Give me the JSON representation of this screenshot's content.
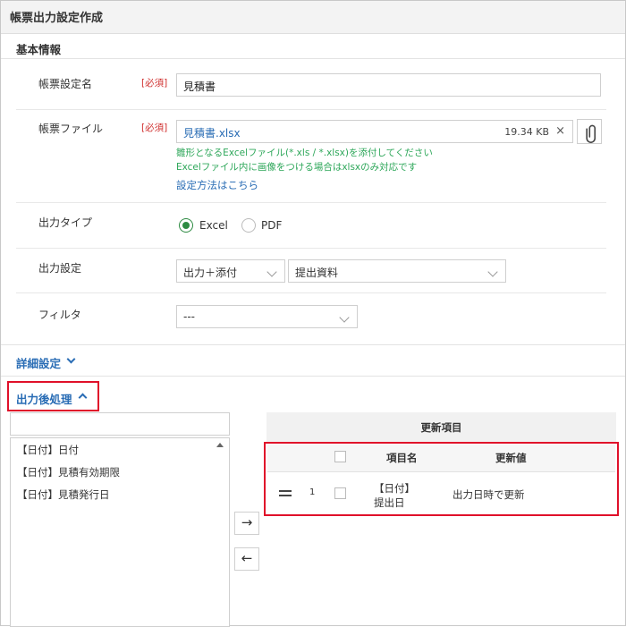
{
  "window": {
    "title": "帳票出力設定作成"
  },
  "basic": {
    "title": "基本情報",
    "report_name": {
      "label": "帳票設定名",
      "required": "[必須]",
      "value": "見積書"
    },
    "report_file": {
      "label": "帳票ファイル",
      "required": "[必須]",
      "file_name": "見積書.xlsx",
      "file_size": "19.34 KB",
      "clear_icon": "×",
      "attach_icon": "paperclip-icon",
      "note1": "雛形となるExcelファイル(*.xls / *.xlsx)を添付してください",
      "note2": "Excelファイル内に画像をつける場合はxlsxのみ対応です",
      "help_link": "設定方法はこちら"
    },
    "output_type": {
      "label": "出力タイプ",
      "options": [
        "Excel",
        "PDF"
      ],
      "selected": "Excel"
    },
    "output_setting": {
      "label": "出力設定",
      "select1": "出力＋添付",
      "select2": "提出資料"
    },
    "filter": {
      "label": "フィルタ",
      "value": "---"
    }
  },
  "detail": {
    "title": "詳細設定"
  },
  "post": {
    "title": "出力後処理",
    "search_placeholder": "",
    "list": [
      "【日付】日付",
      "【日付】見積有効期限",
      "【日付】見積発行日"
    ],
    "buttons": {
      "add": "→",
      "remove": "←"
    },
    "update": {
      "title": "更新項目",
      "columns": {
        "item": "項目名",
        "value": "更新値"
      },
      "rows": [
        {
          "index": "1",
          "item_line1": "【日付】",
          "item_line2": "提出日",
          "value": "出力日時で更新"
        }
      ]
    }
  },
  "colors": {
    "accent": "#2a6db5",
    "required": "#d0302f",
    "note": "#2ea75a",
    "radio": "#2e8b43",
    "highlight": "#e0102a"
  }
}
